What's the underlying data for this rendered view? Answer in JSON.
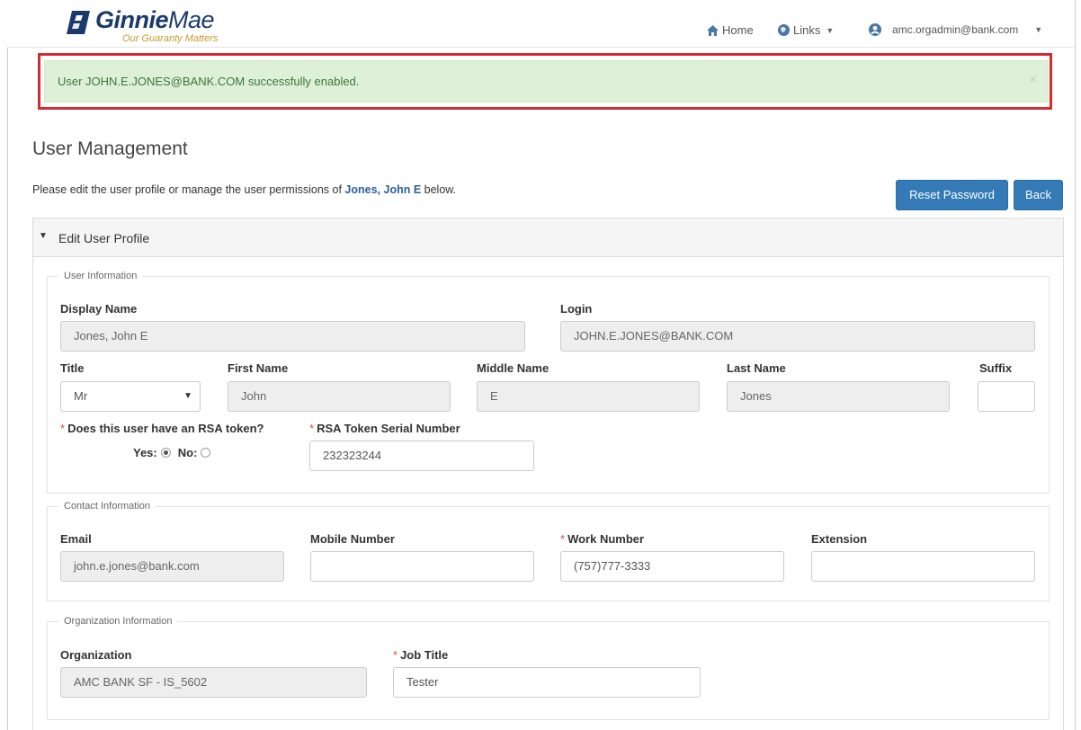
{
  "brand": {
    "name_bold": "Ginnie",
    "name_light": "Mae",
    "tagline": "Our Guaranty Matters",
    "color": "#1b3a6b",
    "accent": "#c79a2e"
  },
  "nav": {
    "home": "Home",
    "links": "Links",
    "user": "amc.orgadmin@bank.com",
    "home_icon": "home-icon",
    "links_icon": "globe-icon",
    "user_icon": "user-circle-icon"
  },
  "alert": {
    "message": "User JOHN.E.JONES@BANK.COM successfully enabled.",
    "close": "×",
    "bg": "#dff0d8",
    "text_color": "#3c763d",
    "highlight_color": "#d42a34"
  },
  "page": {
    "title": "User Management",
    "intro_before": "Please edit the user profile or manage the user permissions of",
    "intro_name": "Jones, John E",
    "intro_after": "below.",
    "reset_password": "Reset Password",
    "back": "Back",
    "primary_color": "#337ab7"
  },
  "panel": {
    "title": "Edit User Profile"
  },
  "user_info": {
    "legend": "User Information",
    "display_name": {
      "label": "Display Name",
      "value": "Jones, John E"
    },
    "login": {
      "label": "Login",
      "value": "JOHN.E.JONES@BANK.COM"
    },
    "title": {
      "label": "Title",
      "value": "Mr"
    },
    "first_name": {
      "label": "First Name",
      "value": "John"
    },
    "middle_name": {
      "label": "Middle Name",
      "value": "E"
    },
    "last_name": {
      "label": "Last Name",
      "value": "Jones"
    },
    "suffix": {
      "label": "Suffix",
      "value": ""
    },
    "rsa_question": "Does this user have an RSA token?",
    "rsa_yes": "Yes:",
    "rsa_no": "No:",
    "rsa_selected": "yes",
    "rsa_serial": {
      "label": "RSA Token Serial Number",
      "value": "232323244"
    }
  },
  "contact_info": {
    "legend": "Contact Information",
    "email": {
      "label": "Email",
      "value": "john.e.jones@bank.com"
    },
    "mobile": {
      "label": "Mobile Number",
      "value": ""
    },
    "work": {
      "label": "Work Number",
      "value": "(757)777-3333"
    },
    "extension": {
      "label": "Extension",
      "value": ""
    }
  },
  "org_info": {
    "legend": "Organization Information",
    "organization": {
      "label": "Organization",
      "value": "AMC BANK SF - IS_5602"
    },
    "job_title": {
      "label": "Job Title",
      "value": "Tester"
    }
  }
}
